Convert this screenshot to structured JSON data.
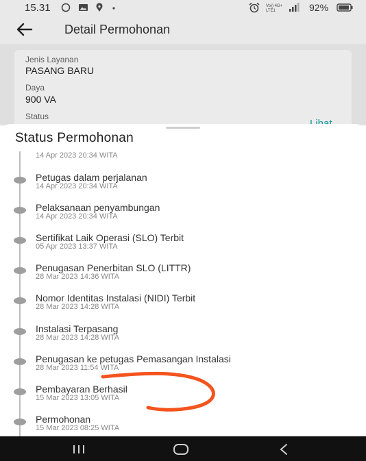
{
  "status_bar": {
    "time": "15.31",
    "network": "Vo)) LTE1 4G+",
    "battery": "92%",
    "icons": [
      "whatsapp-icon",
      "gallery-icon",
      "location-icon",
      "dot-icon",
      "alarm-icon",
      "signal-icon",
      "battery-icon"
    ]
  },
  "header": {
    "title": "Detail Permohonan",
    "back_icon": "arrow-left-icon"
  },
  "details": {
    "jenis_layanan_label": "Jenis Layanan",
    "jenis_layanan_value": "PASANG BARU",
    "daya_label": "Daya",
    "daya_value": "900 VA",
    "status_label": "Status",
    "lihat_link": "Lihat"
  },
  "sheet": {
    "title": "Status Permohonan",
    "items": [
      {
        "title": "",
        "date": "14 Apr 2023 20:34 WITA"
      },
      {
        "title": "Petugas dalam perjalanan",
        "date": "14 Apr 2023 20:34 WITA"
      },
      {
        "title": "Pelaksanaan penyambungan",
        "date": "14 Apr 2023 20:34 WITA"
      },
      {
        "title": "Sertifikat Laik Operasi (SLO) Terbit",
        "date": "05 Apr 2023 13:37 WITA"
      },
      {
        "title": "Penugasan Penerbitan SLO (LITTR)",
        "date": "28 Mar 2023 14:36 WITA"
      },
      {
        "title": "Nomor Identitas Instalasi (NIDI) Terbit",
        "date": "28 Mar 2023 14:28 WITA"
      },
      {
        "title": "Instalasi Terpasang",
        "date": "28 Mar 2023 14:28 WITA"
      },
      {
        "title": "Penugasan ke petugas Pemasangan Instalasi",
        "date": "28 Mar 2023 11:54 WITA"
      },
      {
        "title": "Pembayaran Berhasil",
        "date": "15 Mar 2023 13:05 WITA"
      },
      {
        "title": "Permohonan",
        "date": "15 Mar 2023 08:25 WITA"
      }
    ]
  },
  "annotation_color": "#f4541e",
  "nav_bar": {
    "icons": [
      "recent-apps-icon",
      "home-icon",
      "back-icon"
    ]
  }
}
